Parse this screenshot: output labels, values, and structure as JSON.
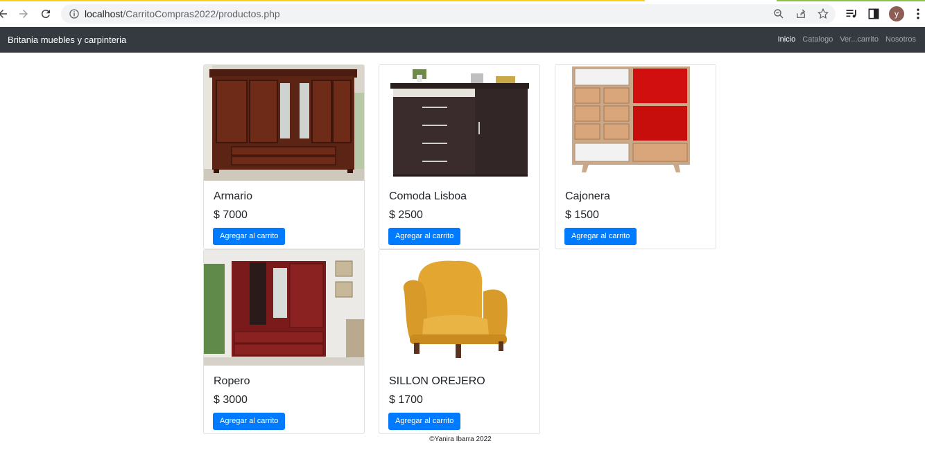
{
  "browser": {
    "url_host": "localhost",
    "url_path": "/CarritoCompras2022/productos.php",
    "avatar_letter": "y"
  },
  "navbar": {
    "brand": "Britania muebles y carpinteria",
    "links": [
      {
        "label": "Inicio",
        "active": true
      },
      {
        "label": "Catalogo",
        "active": false
      },
      {
        "label": "Ver...carrito",
        "active": false
      },
      {
        "label": "Nosotros",
        "active": false
      }
    ]
  },
  "products": [
    {
      "name": "Armario",
      "price": "$ 7000",
      "button": "Agregar al carrito",
      "image": "wardrobe-wood-image"
    },
    {
      "name": "Comoda Lisboa",
      "price": "$ 2500",
      "button": "Agregar al carrito",
      "image": "dresser-dark-image"
    },
    {
      "name": "Cajonera",
      "price": "$ 1500",
      "button": "Agregar al carrito",
      "image": "drawer-cabinet-image"
    },
    {
      "name": "Ropero",
      "price": "$ 3000",
      "button": "Agregar al carrito",
      "image": "wardrobe-red-image"
    },
    {
      "name": "SILLON OREJERO",
      "price": "$ 1700",
      "button": "Agregar al carrito",
      "image": "armchair-yellow-image"
    }
  ],
  "footer": "©Yanira Ibarra 2022",
  "colors": {
    "navbar": "#343a40",
    "button": "#007bff"
  }
}
